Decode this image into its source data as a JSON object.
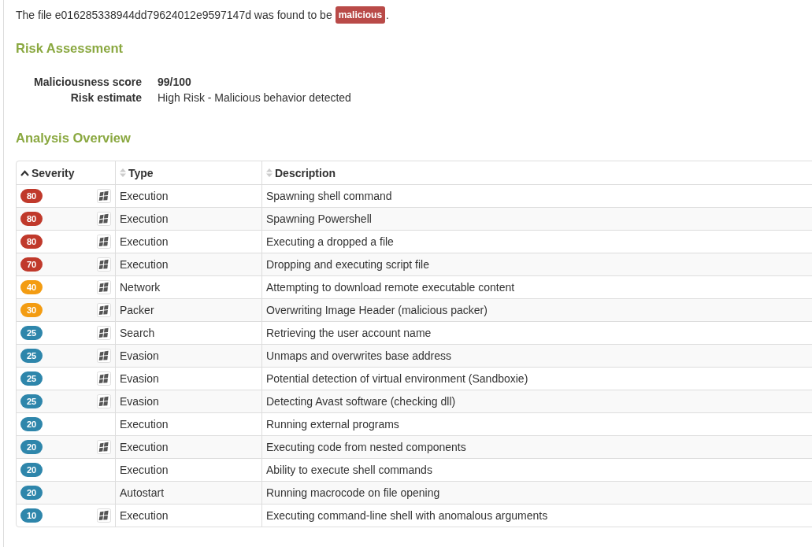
{
  "verdict": {
    "prefix": "The file e016285338944dd79624012e9597147d was found to be",
    "badge": "malicious",
    "suffix": "."
  },
  "risk_assessment": {
    "title": "Risk Assessment",
    "rows": [
      {
        "label": "Maliciousness score",
        "value": "99/100",
        "emphasis": true
      },
      {
        "label": "Risk estimate",
        "value": "High Risk - Malicious behavior detected",
        "emphasis": false
      }
    ]
  },
  "analysis_overview": {
    "title": "Analysis Overview",
    "columns": [
      {
        "label": "Severity",
        "sorted": true
      },
      {
        "label": "Type",
        "sorted": false
      },
      {
        "label": "Description",
        "sorted": false
      }
    ],
    "rows": [
      {
        "severity": "80",
        "color": "#c0392b",
        "os_icon": true,
        "type": "Execution",
        "description": "Spawning shell command"
      },
      {
        "severity": "80",
        "color": "#c0392b",
        "os_icon": true,
        "type": "Execution",
        "description": "Spawning Powershell"
      },
      {
        "severity": "80",
        "color": "#c0392b",
        "os_icon": true,
        "type": "Execution",
        "description": "Executing a dropped a file"
      },
      {
        "severity": "70",
        "color": "#c0392b",
        "os_icon": true,
        "type": "Execution",
        "description": "Dropping and executing script file"
      },
      {
        "severity": "40",
        "color": "#f39c12",
        "os_icon": true,
        "type": "Network",
        "description": "Attempting to download remote executable content"
      },
      {
        "severity": "30",
        "color": "#f39c12",
        "os_icon": true,
        "type": "Packer",
        "description": "Overwriting Image Header (malicious packer)"
      },
      {
        "severity": "25",
        "color": "#2e86ab",
        "os_icon": true,
        "type": "Search",
        "description": "Retrieving the user account name"
      },
      {
        "severity": "25",
        "color": "#2e86ab",
        "os_icon": true,
        "type": "Evasion",
        "description": "Unmaps and overwrites base address"
      },
      {
        "severity": "25",
        "color": "#2e86ab",
        "os_icon": true,
        "type": "Evasion",
        "description": "Potential detection of virtual environment (Sandboxie)"
      },
      {
        "severity": "25",
        "color": "#2e86ab",
        "os_icon": true,
        "type": "Evasion",
        "description": "Detecting Avast software (checking dll)"
      },
      {
        "severity": "20",
        "color": "#2e86ab",
        "os_icon": false,
        "type": "Execution",
        "description": "Running external programs"
      },
      {
        "severity": "20",
        "color": "#2e86ab",
        "os_icon": true,
        "type": "Execution",
        "description": "Executing code from nested components"
      },
      {
        "severity": "20",
        "color": "#2e86ab",
        "os_icon": false,
        "type": "Execution",
        "description": "Ability to execute shell commands"
      },
      {
        "severity": "20",
        "color": "#2e86ab",
        "os_icon": false,
        "type": "Autostart",
        "description": "Running macrocode on file opening"
      },
      {
        "severity": "10",
        "color": "#2e86ab",
        "os_icon": true,
        "type": "Execution",
        "description": "Executing command-line shell with anomalous arguments"
      }
    ]
  }
}
